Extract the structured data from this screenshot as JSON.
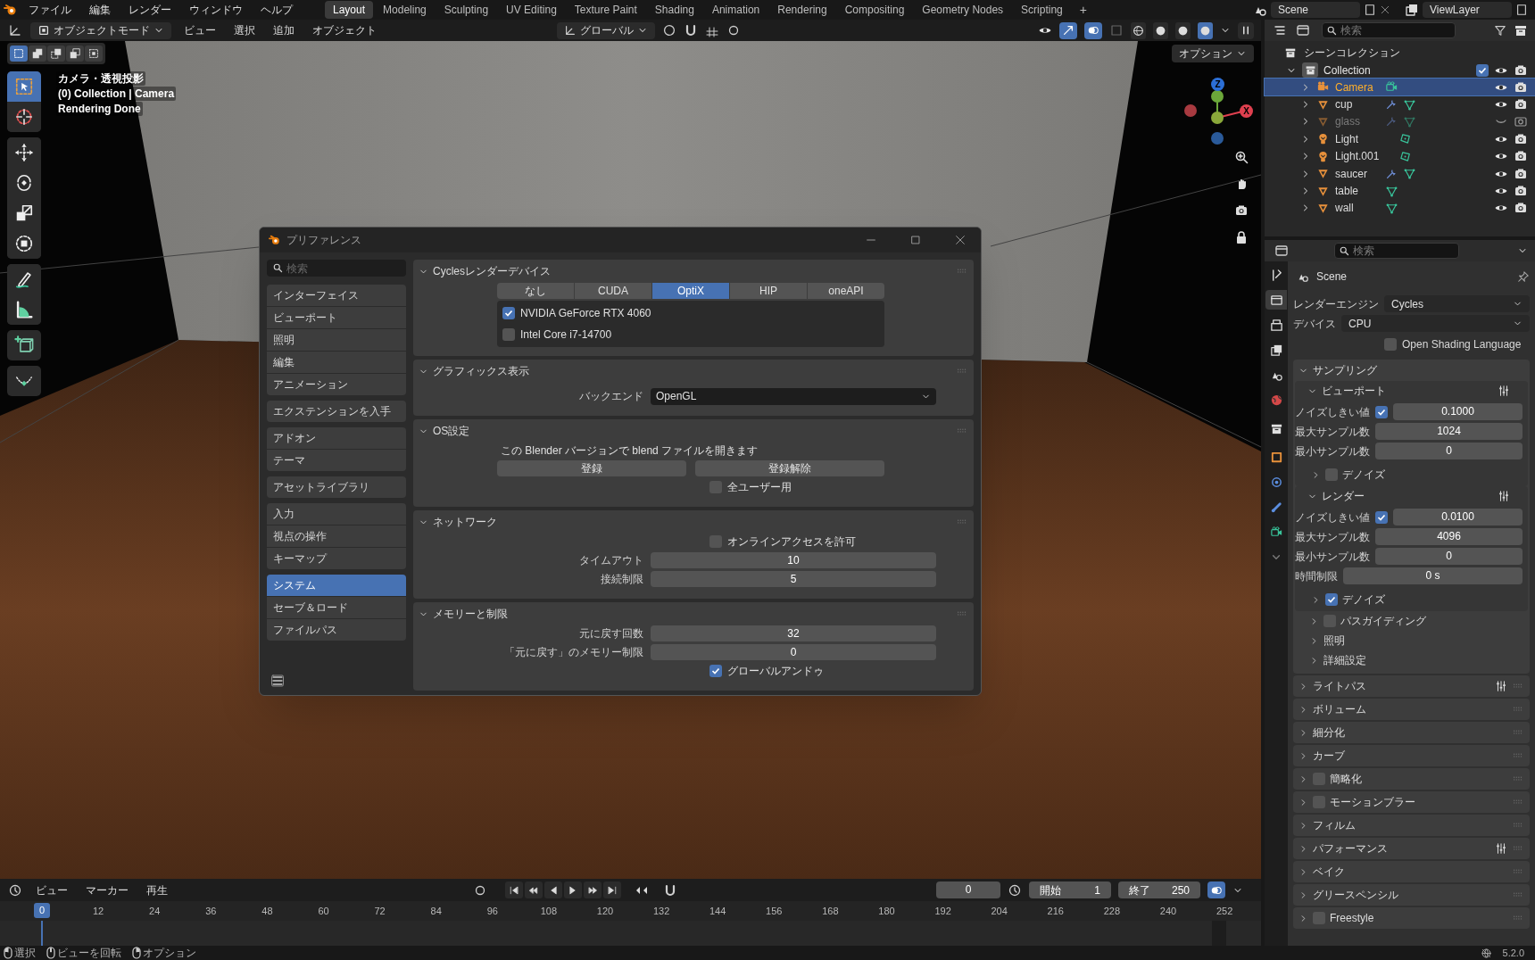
{
  "top_bar": {
    "menus": [
      "ファイル",
      "編集",
      "レンダー",
      "ウィンドウ",
      "ヘルプ"
    ],
    "workspaces": [
      {
        "label": "Layout",
        "selected": true
      },
      {
        "label": "Modeling",
        "selected": false
      },
      {
        "label": "Sculpting",
        "selected": false
      },
      {
        "label": "UV Editing",
        "selected": false
      },
      {
        "label": "Texture Paint",
        "selected": false
      },
      {
        "label": "Shading",
        "selected": false
      },
      {
        "label": "Animation",
        "selected": false
      },
      {
        "label": "Rendering",
        "selected": false
      },
      {
        "label": "Compositing",
        "selected": false
      },
      {
        "label": "Geometry Nodes",
        "selected": false
      },
      {
        "label": "Scripting",
        "selected": false
      }
    ],
    "add_workspace": "+",
    "scene": "Scene",
    "view_layer": "ViewLayer"
  },
  "viewport_header": {
    "mode": "オブジェクトモード",
    "menus": [
      "ビュー",
      "選択",
      "追加",
      "オブジェクト"
    ],
    "orientation": "グローバル",
    "options": "オプション"
  },
  "select_modes": [
    {
      "kind": "set",
      "selected": true
    },
    {
      "kind": "extend",
      "selected": false
    },
    {
      "kind": "subtract",
      "selected": false
    },
    {
      "kind": "difference",
      "selected": false
    },
    {
      "kind": "intersect",
      "selected": false
    }
  ],
  "viewport_info": [
    "カメラ・透視投影",
    "(0) Collection | Camera",
    "Rendering Done"
  ],
  "tools": [
    {
      "kind": "select",
      "selected": true
    },
    {
      "kind": "cursor",
      "selected": false
    },
    {
      "kind": "move",
      "selected": false
    },
    {
      "kind": "rotate",
      "selected": false
    },
    {
      "kind": "scale",
      "selected": false
    },
    {
      "kind": "transform",
      "selected": false
    },
    {
      "kind": "annotate",
      "selected": false
    },
    {
      "kind": "measure",
      "selected": false
    },
    {
      "kind": "add-cube",
      "selected": false
    },
    {
      "kind": "curve",
      "selected": false
    }
  ],
  "gizmo_axes": [
    {
      "label": "Z",
      "color": "#2c6fd6"
    },
    {
      "label": "X",
      "color": "#e0404f"
    }
  ],
  "preferences": {
    "title": "プリファレンス",
    "search_placeholder": "検索",
    "nav_groups": [
      [
        {
          "label": "インターフェイス",
          "selected": false
        },
        {
          "label": "ビューポート",
          "selected": false
        },
        {
          "label": "照明",
          "selected": false
        },
        {
          "label": "編集",
          "selected": false
        },
        {
          "label": "アニメーション",
          "selected": false
        }
      ],
      [
        {
          "label": "エクステンションを入手",
          "selected": false
        }
      ],
      [
        {
          "label": "アドオン",
          "selected": false
        },
        {
          "label": "テーマ",
          "selected": false
        }
      ],
      [
        {
          "label": "アセットライブラリ",
          "selected": false
        }
      ],
      [
        {
          "label": "入力",
          "selected": false
        },
        {
          "label": "視点の操作",
          "selected": false
        },
        {
          "label": "キーマップ",
          "selected": false
        }
      ],
      [
        {
          "label": "システム",
          "selected": true
        },
        {
          "label": "セーブ＆ロード",
          "selected": false
        },
        {
          "label": "ファイルパス",
          "selected": false
        }
      ]
    ],
    "sections": [
      {
        "title": "Cyclesレンダーデバイス",
        "expanded": true,
        "rows": [
          {
            "kind": "backends",
            "options": [
              {
                "label": "なし",
                "selected": false
              },
              {
                "label": "CUDA",
                "selected": false
              },
              {
                "label": "OptiX",
                "selected": true
              },
              {
                "label": "HIP",
                "selected": false
              },
              {
                "label": "oneAPI",
                "selected": false
              }
            ]
          },
          {
            "kind": "devices",
            "devices": [
              {
                "label": "NVIDIA GeForce RTX 4060",
                "checked": true
              },
              {
                "label": "Intel Core i7-14700",
                "checked": false
              }
            ]
          }
        ]
      },
      {
        "title": "グラフィックス表示",
        "expanded": true,
        "rows": [
          {
            "kind": "dropdown",
            "label": "バックエンド",
            "value": "OpenGL"
          }
        ]
      },
      {
        "title": "OS設定",
        "expanded": true,
        "rows": [
          {
            "kind": "text",
            "text": "この Blender バージョンで blend ファイルを開きます"
          },
          {
            "kind": "buttons",
            "buttons": [
              "登録",
              "登録解除"
            ]
          },
          {
            "kind": "checkbox",
            "label": "全ユーザー用",
            "checked": false
          }
        ]
      },
      {
        "title": "ネットワーク",
        "expanded": true,
        "rows": [
          {
            "kind": "checkbox",
            "label": "オンラインアクセスを許可",
            "checked": false
          },
          {
            "kind": "number",
            "label": "タイムアウト",
            "value": "10"
          },
          {
            "kind": "number",
            "label": "接続制限",
            "value": "5"
          }
        ]
      },
      {
        "title": "メモリーと制限",
        "expanded": true,
        "rows": [
          {
            "kind": "number",
            "label": "元に戻す回数",
            "value": "32"
          },
          {
            "kind": "number",
            "label": "「元に戻す」のメモリー制限",
            "value": "0"
          },
          {
            "kind": "checkbox",
            "label": "グローバルアンドゥ",
            "checked": true
          }
        ]
      }
    ]
  },
  "outliner": {
    "search_placeholder": "検索",
    "root": "シーンコレクション",
    "collection": {
      "name": "Collection",
      "expanded": true,
      "checked": true,
      "children": [
        {
          "name": "Camera",
          "kind": "camera",
          "selected": true,
          "visible": true,
          "modifier": false
        },
        {
          "name": "cup",
          "kind": "mesh",
          "selected": false,
          "visible": true,
          "modifier": true
        },
        {
          "name": "glass",
          "kind": "mesh",
          "selected": false,
          "visible": false,
          "modifier": true
        },
        {
          "name": "Light",
          "kind": "light",
          "selected": false,
          "visible": true,
          "modifier": false
        },
        {
          "name": "Light.001",
          "kind": "light",
          "selected": false,
          "visible": true,
          "modifier": false
        },
        {
          "name": "saucer",
          "kind": "mesh",
          "selected": false,
          "visible": true,
          "modifier": true
        },
        {
          "name": "table",
          "kind": "mesh",
          "selected": false,
          "visible": true,
          "modifier": false
        },
        {
          "name": "wall",
          "kind": "mesh",
          "selected": false,
          "visible": true,
          "modifier": false
        }
      ]
    }
  },
  "properties": {
    "search_placeholder": "検索",
    "context": "Scene",
    "tabs": [
      {
        "kind": "tool",
        "selected": false
      },
      {
        "kind": "render",
        "selected": true
      },
      {
        "kind": "output",
        "selected": false
      },
      {
        "kind": "view-layer",
        "selected": false
      },
      {
        "kind": "scene",
        "selected": false
      },
      {
        "kind": "world",
        "selected": false
      },
      {
        "kind": "collection",
        "selected": false
      },
      {
        "kind": "object",
        "selected": false
      },
      {
        "kind": "physics",
        "selected": false
      },
      {
        "kind": "constraint",
        "selected": false
      },
      {
        "kind": "camera-data",
        "selected": false
      },
      {
        "kind": "more",
        "selected": false
      }
    ],
    "render_engine": {
      "label": "レンダーエンジン",
      "value": "Cycles"
    },
    "device": {
      "label": "デバイス",
      "value": "CPU"
    },
    "osl": {
      "label": "Open Shading Language",
      "checked": false
    },
    "sampling": {
      "title": "サンプリング",
      "expanded": true,
      "groups": [
        {
          "title": "ビューポート",
          "expanded": true,
          "rows": [
            {
              "kind": "toggle-number",
              "label": "ノイズしきい値",
              "checked": true,
              "value": "0.1000"
            },
            {
              "kind": "number",
              "label": "最大サンプル数",
              "value": "1024"
            },
            {
              "kind": "number",
              "label": "最小サンプル数",
              "value": "0"
            }
          ],
          "subpanels": [
            {
              "title": "デノイズ",
              "checked": false
            }
          ]
        },
        {
          "title": "レンダー",
          "expanded": true,
          "rows": [
            {
              "kind": "toggle-number",
              "label": "ノイズしきい値",
              "checked": true,
              "value": "0.0100"
            },
            {
              "kind": "number",
              "label": "最大サンプル数",
              "value": "4096"
            },
            {
              "kind": "number",
              "label": "最小サンプル数",
              "value": "0"
            },
            {
              "kind": "number",
              "label": "時間制限",
              "value": "0 s"
            }
          ],
          "subpanels": [
            {
              "title": "デノイズ",
              "checked": true
            }
          ]
        }
      ],
      "subpanels": [
        {
          "title": "パスガイディング",
          "checked": false
        },
        {
          "title": "照明"
        },
        {
          "title": "詳細設定"
        }
      ]
    },
    "panels": [
      {
        "title": "ライトパス",
        "presets": true
      },
      {
        "title": "ボリューム",
        "presets": false
      },
      {
        "title": "細分化",
        "presets": false
      },
      {
        "title": "カーブ",
        "presets": false
      },
      {
        "title": "簡略化",
        "presets": false,
        "checked": false
      },
      {
        "title": "モーションブラー",
        "presets": false,
        "checked": false
      },
      {
        "title": "フィルム",
        "presets": false
      },
      {
        "title": "パフォーマンス",
        "presets": true
      },
      {
        "title": "ベイク",
        "presets": false
      },
      {
        "title": "グリースペンシル",
        "presets": false
      },
      {
        "title": "Freestyle",
        "presets": false,
        "checked": false
      }
    ]
  },
  "timeline": {
    "menus": [
      "ビュー",
      "マーカー",
      "再生"
    ],
    "current_frame": "0",
    "start": {
      "label": "開始",
      "value": "1"
    },
    "end": {
      "label": "終了",
      "value": "250"
    },
    "playhead": "0",
    "ticks": [
      "12",
      "24",
      "36",
      "48",
      "60",
      "72",
      "84",
      "96",
      "108",
      "120",
      "132",
      "144",
      "156",
      "168",
      "180",
      "192",
      "204",
      "216",
      "228",
      "240",
      "252"
    ]
  },
  "status_bar": {
    "hints": [
      {
        "kind": "left-click",
        "label": "選択"
      },
      {
        "kind": "middle-click",
        "label": "ビューを回転"
      },
      {
        "kind": "right-click",
        "label": "オプション"
      }
    ],
    "version": "5.2.0"
  }
}
